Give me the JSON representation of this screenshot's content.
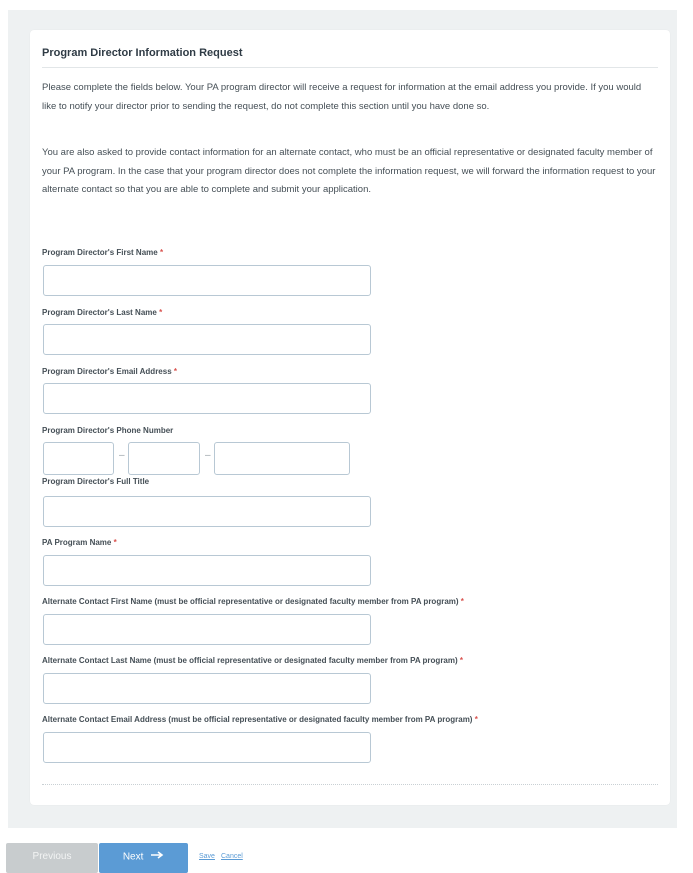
{
  "card": {
    "title": "Program Director Information Request",
    "para1": "Please complete the fields below. Your PA program director will receive a request for information at the email address you provide. If you would like to notify your director prior to sending the request, do not complete this section until you have done so.",
    "para2": "You are also asked to provide contact information for an alternate contact, who must be an official representative or designated faculty member of your PA program. In the case that your program director does not complete the information request, we will forward the information request to your alternate contact so that you are able to complete and submit your application."
  },
  "fields": {
    "first_name": {
      "label": "Program Director's First Name",
      "required": "*",
      "value": ""
    },
    "last_name": {
      "label": "Program Director's Last Name",
      "required": "*",
      "value": ""
    },
    "email": {
      "label": "Program Director's Email Address",
      "required": "*",
      "value": ""
    },
    "phone": {
      "label": "Program Director's Phone Number",
      "sep": "–"
    },
    "title": {
      "label": "Program Director's Full Title",
      "value": ""
    },
    "program_name": {
      "label": "PA Program Name",
      "required": "*",
      "value": ""
    },
    "alt_first": {
      "label": "Alternate Contact First Name (must be official representative or designated faculty member from PA program)",
      "required": "*",
      "value": ""
    },
    "alt_last": {
      "label": "Alternate Contact Last Name (must be official representative or designated faculty member from PA program)",
      "required": "*",
      "value": ""
    },
    "alt_email": {
      "label": "Alternate Contact Email Address (must be official representative or designated faculty member from PA program)",
      "required": "*",
      "value": ""
    }
  },
  "footer": {
    "previous": "Previous",
    "next": "Next",
    "next_icon": "arrow-right-icon",
    "save": "Save",
    "cancel": "Cancel"
  },
  "colors": {
    "accent": "#5b9bd5",
    "required": "#d9534f",
    "disabled": "#c8ccce"
  }
}
